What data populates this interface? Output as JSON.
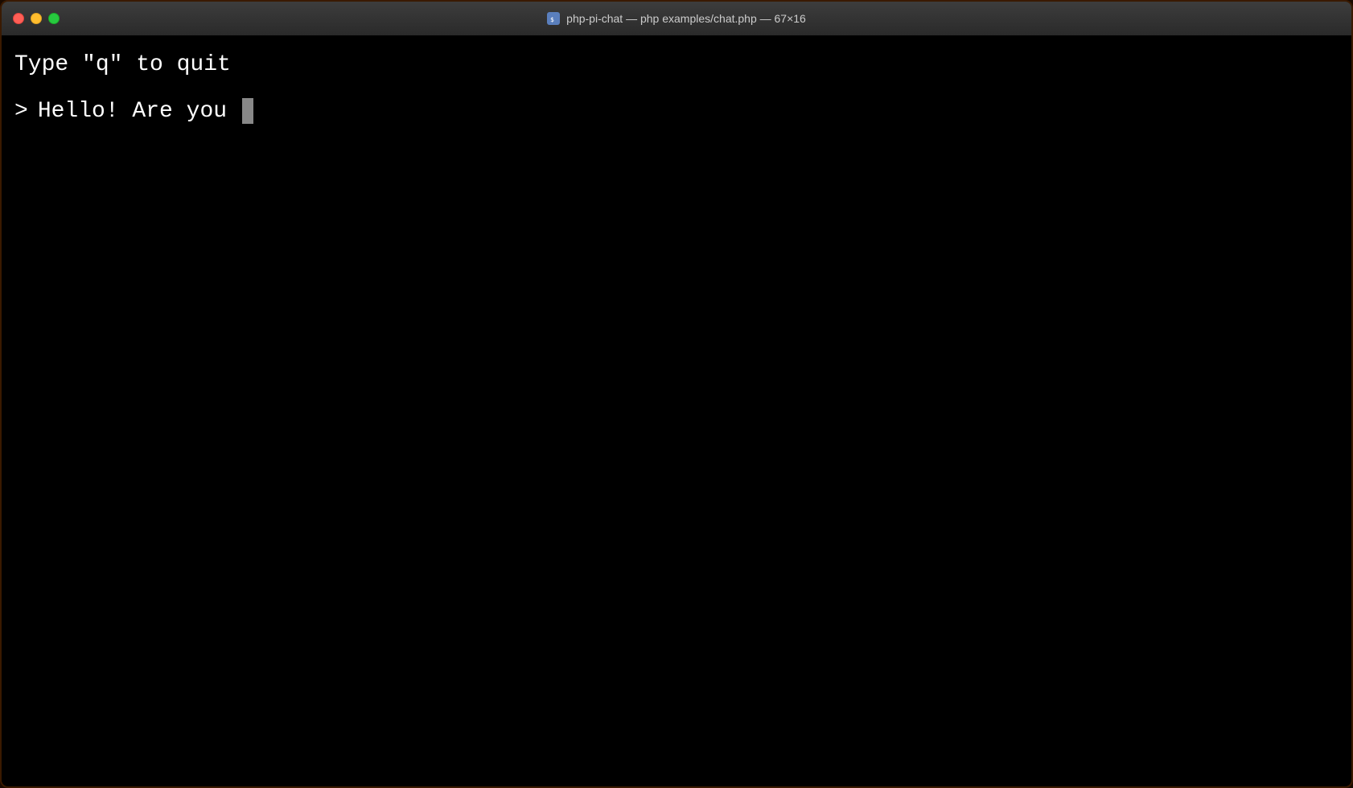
{
  "titleBar": {
    "title": "php-pi-chat — php examples/chat.php — 67×16",
    "trafficLights": {
      "close": "close",
      "minimize": "minimize",
      "maximize": "maximize"
    }
  },
  "terminal": {
    "instructionLine": "Type \"q\" to quit",
    "promptSymbol": ">",
    "inputText": "Hello! Are you "
  }
}
